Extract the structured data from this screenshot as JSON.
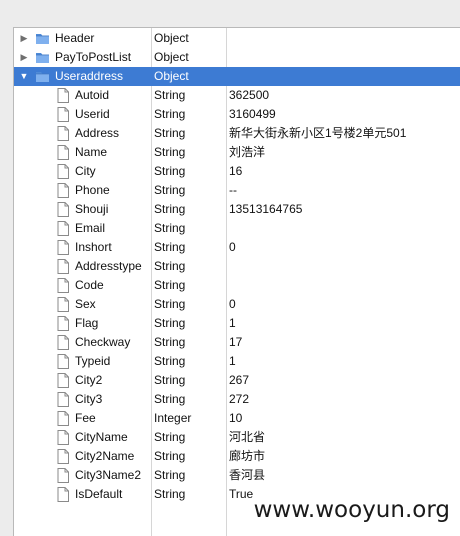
{
  "rows": [
    {
      "key": "Header",
      "type": "Object",
      "value": "",
      "kind": "folder",
      "disclosure": "collapsed",
      "indent": 0
    },
    {
      "key": "PayToPostList",
      "type": "Object",
      "value": "",
      "kind": "folder",
      "disclosure": "collapsed",
      "indent": 0
    },
    {
      "key": "Useraddress",
      "type": "Object",
      "value": "",
      "kind": "folder",
      "disclosure": "expanded",
      "indent": 0,
      "selected": true
    },
    {
      "key": "Autoid",
      "type": "String",
      "value": "362500",
      "kind": "file",
      "indent": 1
    },
    {
      "key": "Userid",
      "type": "String",
      "value": "3160499",
      "kind": "file",
      "indent": 1
    },
    {
      "key": "Address",
      "type": "String",
      "value": "新华大街永新小区1号楼2单元501",
      "kind": "file",
      "indent": 1
    },
    {
      "key": "Name",
      "type": "String",
      "value": "刘浩洋",
      "kind": "file",
      "indent": 1
    },
    {
      "key": "City",
      "type": "String",
      "value": "16",
      "kind": "file",
      "indent": 1
    },
    {
      "key": "Phone",
      "type": "String",
      "value": "--",
      "kind": "file",
      "indent": 1
    },
    {
      "key": "Shouji",
      "type": "String",
      "value": "13513164765",
      "kind": "file",
      "indent": 1
    },
    {
      "key": "Email",
      "type": "String",
      "value": "",
      "kind": "file",
      "indent": 1
    },
    {
      "key": "Inshort",
      "type": "String",
      "value": "0",
      "kind": "file",
      "indent": 1
    },
    {
      "key": "Addresstype",
      "type": "String",
      "value": "",
      "kind": "file",
      "indent": 1
    },
    {
      "key": "Code",
      "type": "String",
      "value": "",
      "kind": "file",
      "indent": 1
    },
    {
      "key": "Sex",
      "type": "String",
      "value": "0",
      "kind": "file",
      "indent": 1
    },
    {
      "key": "Flag",
      "type": "String",
      "value": "1",
      "kind": "file",
      "indent": 1
    },
    {
      "key": "Checkway",
      "type": "String",
      "value": "17",
      "kind": "file",
      "indent": 1
    },
    {
      "key": "Typeid",
      "type": "String",
      "value": "1",
      "kind": "file",
      "indent": 1
    },
    {
      "key": "City2",
      "type": "String",
      "value": "267",
      "kind": "file",
      "indent": 1
    },
    {
      "key": "City3",
      "type": "String",
      "value": "272",
      "kind": "file",
      "indent": 1
    },
    {
      "key": "Fee",
      "type": "Integer",
      "value": "10",
      "kind": "file",
      "indent": 1
    },
    {
      "key": "CityName",
      "type": "String",
      "value": "河北省",
      "kind": "file",
      "indent": 1
    },
    {
      "key": "City2Name",
      "type": "String",
      "value": "廊坊市",
      "kind": "file",
      "indent": 1
    },
    {
      "key": "City3Name2",
      "type": "String",
      "value": "香河县",
      "kind": "file",
      "indent": 1
    },
    {
      "key": "IsDefault",
      "type": "String",
      "value": "True",
      "kind": "file",
      "indent": 1
    }
  ],
  "watermark": "www.wooyun.org",
  "colors": {
    "selection": "#3d7bd3",
    "folder": "#5f9be3",
    "grid": "#d6d6d6"
  },
  "icons": {
    "folder": "folder-icon",
    "file": "document-icon",
    "collapsed": "disclosure-triangle-right-icon",
    "expanded": "disclosure-triangle-down-icon"
  }
}
